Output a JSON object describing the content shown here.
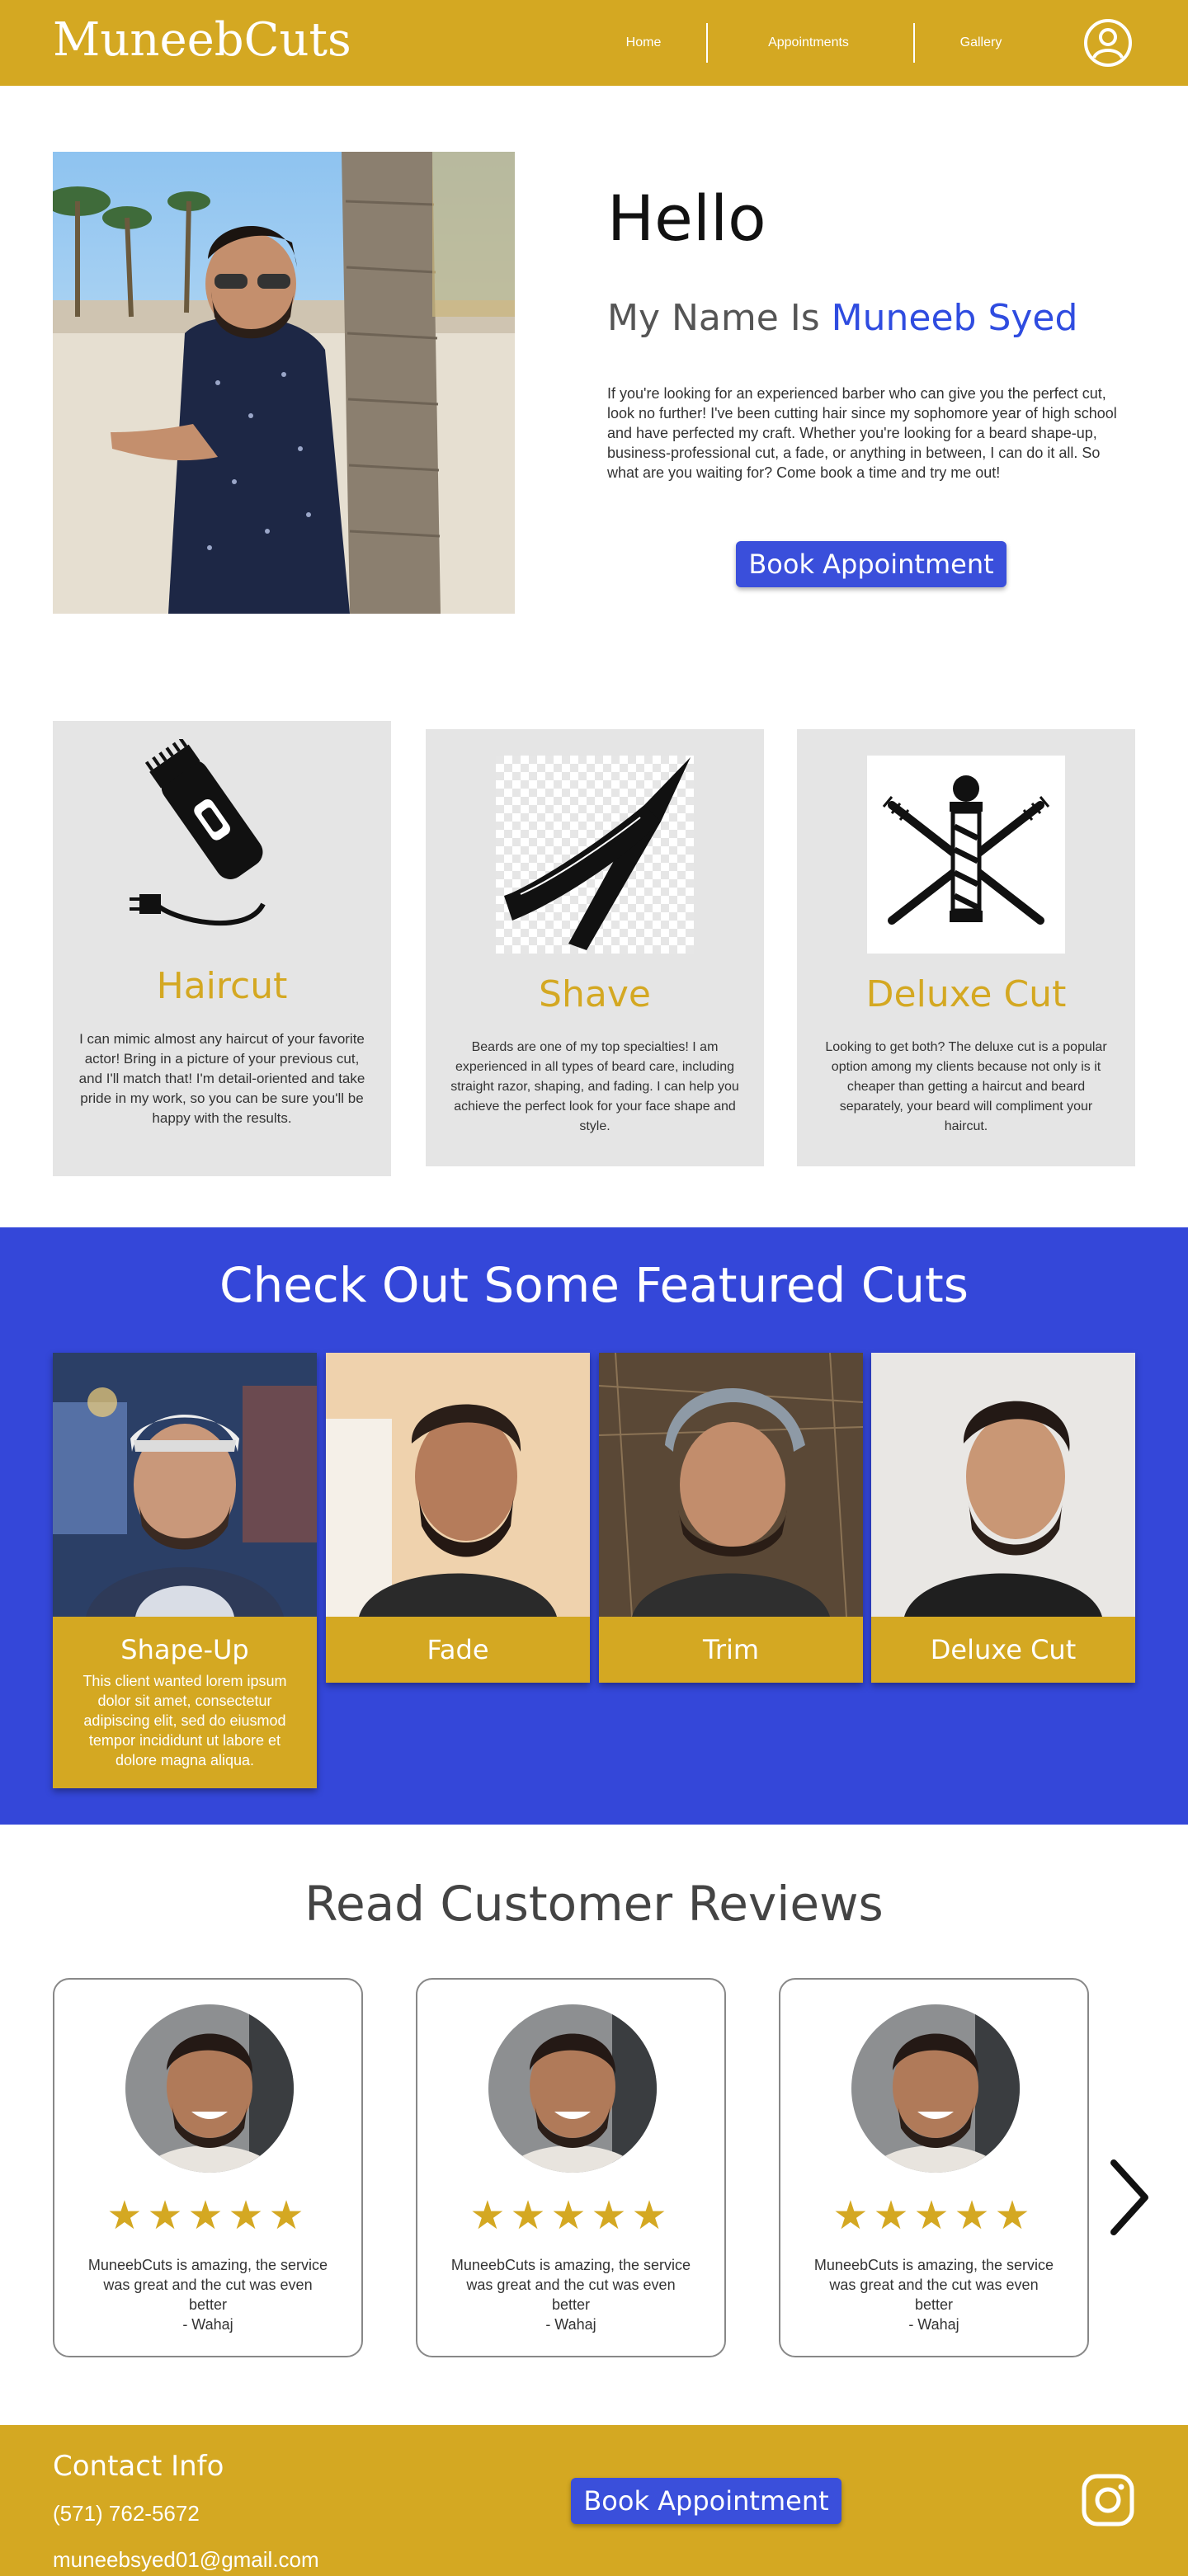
{
  "header": {
    "logo": "MuneebCuts",
    "nav": [
      "Home",
      "Appointments",
      "Gallery"
    ],
    "profile_icon": "user-circle-icon"
  },
  "hero": {
    "hello": "Hello",
    "name_prefix": "My Name Is ",
    "name": "Muneeb Syed",
    "intro": "If you're looking for an experienced barber who can give you the perfect cut, look no further! I've been cutting hair since my sophomore year of high school and have perfected my craft. Whether you're looking for a beard shape-up, business-professional cut, a fade, or anything in between, I can do it all. So what are you waiting for? Come book a time and try me out!",
    "button": "Book Appointment"
  },
  "services": [
    {
      "title": "Haircut",
      "icon": "hair-clipper-icon",
      "desc": "I can mimic almost any haircut of your favorite actor! Bring in a picture of your previous cut, and I'll match that! I'm detail-oriented and take pride in my work, so you can be sure you'll be happy with the results."
    },
    {
      "title": "Shave",
      "icon": "straight-razor-icon",
      "desc": "Beards are one of my top specialties! I am experienced in all types of beard care, including straight razor, shaping, and fading. I can help you achieve the perfect look for your face shape and style."
    },
    {
      "title": "Deluxe Cut",
      "icon": "barber-pole-icon",
      "desc": "Looking to get both? The deluxe cut is a popular option among my clients because not only is it cheaper than getting a haircut and beard separately, your beard will compliment your haircut."
    }
  ],
  "featured": {
    "title": "Check Out Some Featured Cuts",
    "cuts": [
      {
        "label": "Shape-Up",
        "desc": "This client wanted lorem ipsum dolor sit amet, consectetur adipiscing elit, sed do eiusmod tempor incididunt ut labore et dolore magna aliqua."
      },
      {
        "label": "Fade"
      },
      {
        "label": "Trim"
      },
      {
        "label": "Deluxe Cut"
      }
    ]
  },
  "reviews": {
    "title": "Read Customer Reviews",
    "items": [
      {
        "stars": "★★★★★",
        "text": "MuneebCuts is amazing, the service was great and the cut was even better",
        "author": "- Wahaj"
      },
      {
        "stars": "★★★★★",
        "text": "MuneebCuts is amazing, the service was great and the cut was even better",
        "author": "- Wahaj"
      },
      {
        "stars": "★★★★★",
        "text": "MuneebCuts is amazing, the service was great and the cut was even better",
        "author": "- Wahaj"
      }
    ],
    "next_icon": "chevron-right-icon"
  },
  "footer": {
    "title": "Contact Info",
    "phone": "(571) 762-5672",
    "email": "muneebsyed01@gmail.com",
    "button": "Book Appointment",
    "social_icon": "instagram-icon"
  },
  "colors": {
    "gold": "#D4A822",
    "blue": "#3447D9",
    "card_grey": "#E5E5E5"
  }
}
